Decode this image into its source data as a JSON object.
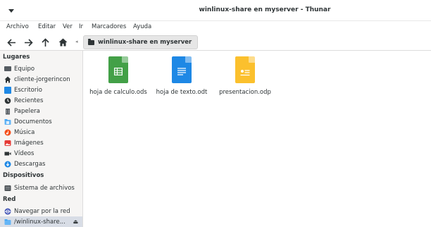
{
  "window": {
    "title": "winlinux-share en myserver - Thunar"
  },
  "menubar": {
    "items": [
      "Archivo",
      "Editar",
      "Ver",
      "Ir",
      "Marcadores",
      "Ayuda"
    ]
  },
  "toolbar": {
    "path_label": "winlinux-share en myserver"
  },
  "sidebar": {
    "sections": {
      "places": "Lugares",
      "devices": "Dispositivos",
      "network": "Red"
    },
    "places": [
      {
        "label": "Equipo",
        "icon": "computer-icon"
      },
      {
        "label": "cliente-jorgerincon",
        "icon": "home-icon"
      },
      {
        "label": "Escritorio",
        "icon": "desktop-icon"
      },
      {
        "label": "Recientes",
        "icon": "clock-icon"
      },
      {
        "label": "Papelera",
        "icon": "trash-icon"
      },
      {
        "label": "Documentos",
        "icon": "documents-folder-icon"
      },
      {
        "label": "Música",
        "icon": "music-icon"
      },
      {
        "label": "Imágenes",
        "icon": "pictures-icon"
      },
      {
        "label": "Vídeos",
        "icon": "video-icon"
      },
      {
        "label": "Descargas",
        "icon": "downloads-icon"
      }
    ],
    "devices": [
      {
        "label": "Sistema de archivos",
        "icon": "drive-icon"
      }
    ],
    "network": [
      {
        "label": "Navegar por la red",
        "icon": "network-icon"
      },
      {
        "label": "/winlinux-share...",
        "icon": "network-folder-icon",
        "selected": true
      }
    ]
  },
  "files": [
    {
      "name": "hoja de calculo.ods",
      "icon": "spreadsheet-icon",
      "color": "#43a047"
    },
    {
      "name": "hoja de texto.odt",
      "icon": "text-document-icon",
      "color": "#1e88e5"
    },
    {
      "name": "presentacion.odp",
      "icon": "presentation-icon",
      "color": "#fbc02d"
    }
  ]
}
